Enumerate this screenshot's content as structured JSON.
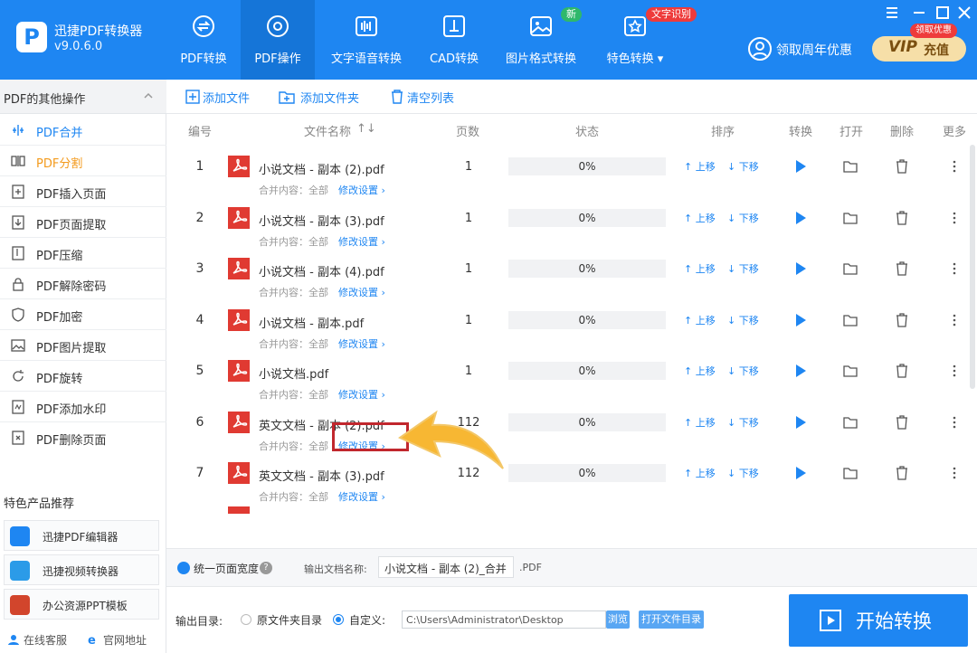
{
  "header": {
    "app_name": "迅捷PDF转换器",
    "version": "v9.0.6.0",
    "nav": [
      {
        "label": "PDF转换",
        "icon": "convert-icon"
      },
      {
        "label": "PDF操作",
        "icon": "gear-icon"
      },
      {
        "label": "文字语音转换",
        "icon": "audio-icon"
      },
      {
        "label": "CAD转换",
        "icon": "cad-icon"
      },
      {
        "label": "图片格式转换",
        "icon": "image-icon"
      },
      {
        "label": "特色转换 ▾",
        "icon": "star-icon"
      }
    ],
    "badge_new": "新",
    "badge_ocr": "文字识别",
    "promo": "领取周年优惠",
    "vip_text": "VIP",
    "vip_recharge": "充值",
    "vip_badge": "领取优惠",
    "accent": "#1e86f2"
  },
  "sidebar": {
    "title": "PDF的其他操作",
    "items": [
      {
        "label": "PDF合并",
        "icon": "merge-icon"
      },
      {
        "label": "PDF分割",
        "icon": "split-icon"
      },
      {
        "label": "PDF插入页面",
        "icon": "insert-page-icon"
      },
      {
        "label": "PDF页面提取",
        "icon": "extract-page-icon"
      },
      {
        "label": "PDF压缩",
        "icon": "compress-icon"
      },
      {
        "label": "PDF解除密码",
        "icon": "unlock-icon"
      },
      {
        "label": "PDF加密",
        "icon": "shield-icon"
      },
      {
        "label": "PDF图片提取",
        "icon": "image-extract-icon"
      },
      {
        "label": "PDF旋转",
        "icon": "rotate-icon"
      },
      {
        "label": "PDF添加水印",
        "icon": "watermark-icon"
      },
      {
        "label": "PDF删除页面",
        "icon": "delete-page-icon"
      }
    ],
    "rec_title": "特色产品推荐",
    "recommendations": [
      {
        "label": "迅捷PDF编辑器"
      },
      {
        "label": "迅捷视频转换器"
      },
      {
        "label": "办公资源PPT模板"
      }
    ],
    "online_service": "在线客服",
    "website": "官网地址"
  },
  "toolbar": {
    "add_file": "添加文件",
    "add_folder": "添加文件夹",
    "clear_list": "清空列表"
  },
  "table": {
    "headers": {
      "index": "编号",
      "name": "文件名称",
      "pages": "页数",
      "status": "状态",
      "sort": "排序",
      "convert": "转换",
      "open": "打开",
      "delete": "删除",
      "more": "更多"
    },
    "move_up": "上移",
    "move_down": "下移",
    "merge_label": "合并内容：全部",
    "modify_label": "修改设置 ›",
    "rows": [
      {
        "index": "1",
        "name": "小说文档 - 副本 (2).pdf",
        "pages": "1",
        "progress": "0%"
      },
      {
        "index": "2",
        "name": "小说文档 - 副本 (3).pdf",
        "pages": "1",
        "progress": "0%"
      },
      {
        "index": "3",
        "name": "小说文档 - 副本 (4).pdf",
        "pages": "1",
        "progress": "0%"
      },
      {
        "index": "4",
        "name": "小说文档 - 副本.pdf",
        "pages": "1",
        "progress": "0%"
      },
      {
        "index": "5",
        "name": "小说文档.pdf",
        "pages": "1",
        "progress": "0%"
      },
      {
        "index": "6",
        "name": "英文文档 - 副本 (2).pdf",
        "pages": "112",
        "progress": "0%"
      },
      {
        "index": "7",
        "name": "英文文档 - 副本 (3).pdf",
        "pages": "112",
        "progress": "0%"
      }
    ]
  },
  "options": {
    "unify_width": "统一页面宽度",
    "output_name_label": "输出文档名称:",
    "output_name": "小说文档 - 副本 (2)_合并",
    "ext": ".PDF"
  },
  "output": {
    "dir_label": "输出目录:",
    "opt_original": "原文件夹目录",
    "opt_custom": "自定义:",
    "path": "C:\\Users\\Administrator\\Desktop",
    "browse": "浏览",
    "open_dir": "打开文件目录",
    "start": "开始转换"
  }
}
